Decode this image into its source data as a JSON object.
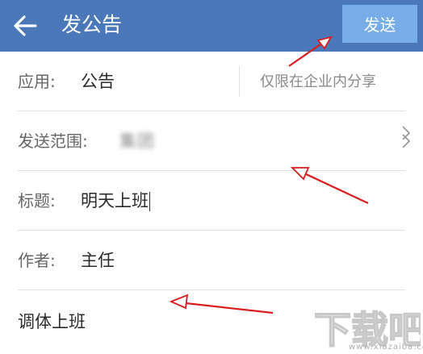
{
  "header": {
    "title": "发公告",
    "send_label": "发送"
  },
  "form": {
    "app": {
      "label": "应用:",
      "value": "公告",
      "share_option": "仅限在企业内分享"
    },
    "scope": {
      "label": "发送范围:",
      "value_blurred": "集团",
      "value_suffix": "集团"
    },
    "title": {
      "label": "标题:",
      "value": "明天上班"
    },
    "author": {
      "label": "作者:",
      "value": "主任"
    },
    "body": {
      "value": "调体上班"
    }
  },
  "watermark": {
    "logo_text": "下载吧",
    "url": "www.xiazaiba.com"
  },
  "colors": {
    "header_bg": "#4a78b8",
    "send_button_bg": "#78aee8",
    "annotation_arrow": "#d81e1e"
  },
  "icons": [
    "back-arrow-icon",
    "chevron-right-icon",
    "annotation-arrow-icon",
    "watermark-logo-icon"
  ]
}
